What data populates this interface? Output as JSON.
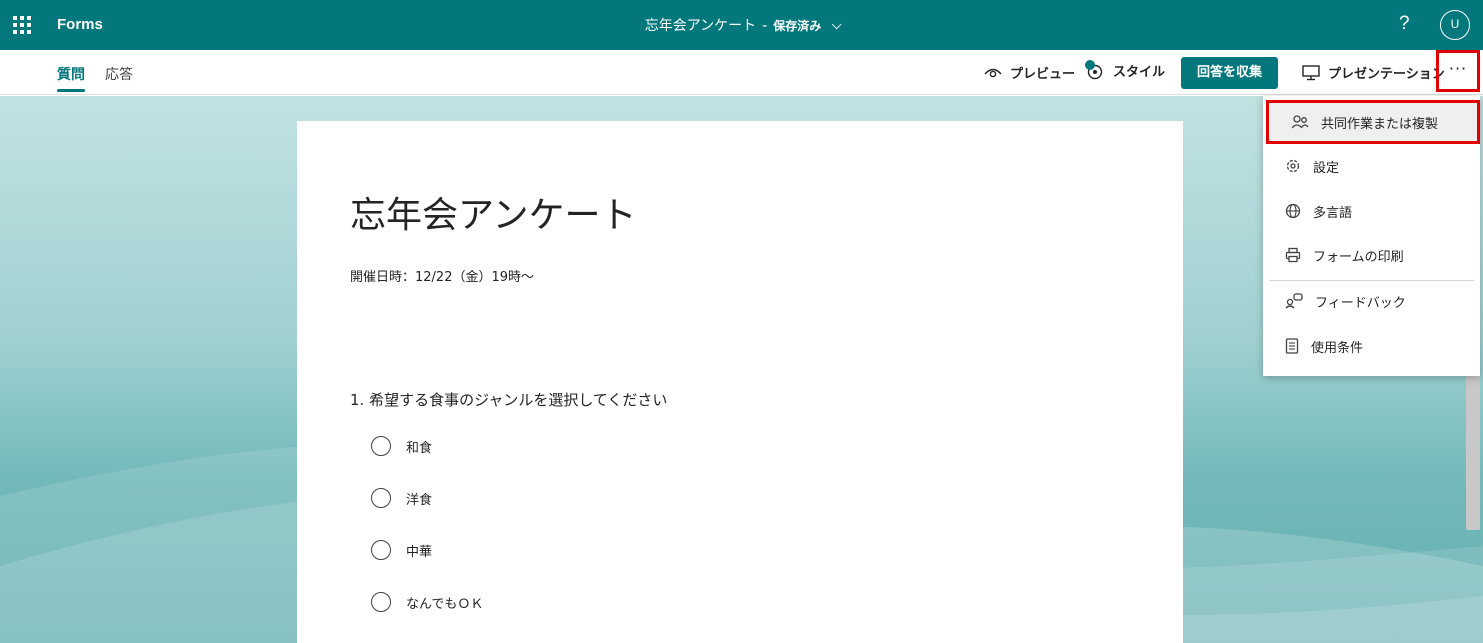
{
  "topbar": {
    "app_name": "Forms",
    "doc_title": "忘年会アンケート",
    "separator": "-",
    "save_status": "保存済み",
    "help_label": "?",
    "avatar_initial": "U"
  },
  "tabs": [
    {
      "label": "質問"
    },
    {
      "label": "応答"
    }
  ],
  "commands": {
    "preview": "プレビュー",
    "style": "スタイル",
    "collect": "回答を収集",
    "present": "プレゼンテーション",
    "more": "···"
  },
  "form": {
    "title": "忘年会アンケート",
    "description": "開催日時：12/22（金）19時～",
    "question": "1. 希望する食事のジャンルを選択してください",
    "options": [
      "和食",
      "洋食",
      "中華",
      "なんでもＯＫ"
    ]
  },
  "menu": {
    "items": [
      {
        "label": "共同作業または複製",
        "icon": "people-icon"
      },
      {
        "label": "設定",
        "icon": "gear-icon"
      },
      {
        "label": "多言語",
        "icon": "globe-icon"
      },
      {
        "label": "フォームの印刷",
        "icon": "printer-icon"
      },
      {
        "label": "フィードバック",
        "icon": "feedback-icon"
      },
      {
        "label": "使用条件",
        "icon": "document-icon"
      }
    ]
  },
  "colors": {
    "brand": "#03787c",
    "highlight_border": "#e00000"
  }
}
